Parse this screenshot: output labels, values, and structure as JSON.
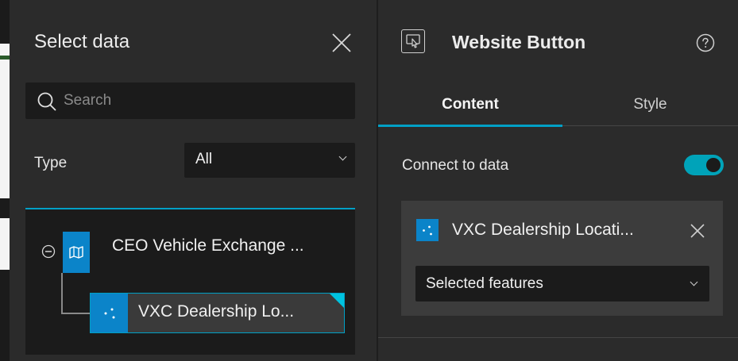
{
  "select_data_panel": {
    "title": "Select data",
    "search_placeholder": "Search",
    "type_label": "Type",
    "type_value": "All",
    "tree": {
      "parent_label": "CEO Vehicle Exchange ...",
      "child_label": "VXC Dealership Lo..."
    }
  },
  "settings_panel": {
    "title": "Website Button",
    "tabs": [
      {
        "label": "Content",
        "active": true
      },
      {
        "label": "Style",
        "active": false
      }
    ],
    "connect_label": "Connect to data",
    "connect_enabled": true,
    "data_source": {
      "label": "VXC Dealership Locati...",
      "filter_value": "Selected features"
    }
  },
  "colors": {
    "accent": "#00a0c6",
    "toggle": "#00a3b9",
    "layer_icon": "#0b84c9",
    "panel_bg": "#2b2b2b",
    "input_bg": "#1b1b1b"
  },
  "icons": [
    "search-icon",
    "close-icon",
    "chevron-down-icon",
    "collapse-minus-icon",
    "map-icon",
    "point-layer-icon",
    "website-button-icon",
    "help-icon",
    "remove-icon"
  ]
}
